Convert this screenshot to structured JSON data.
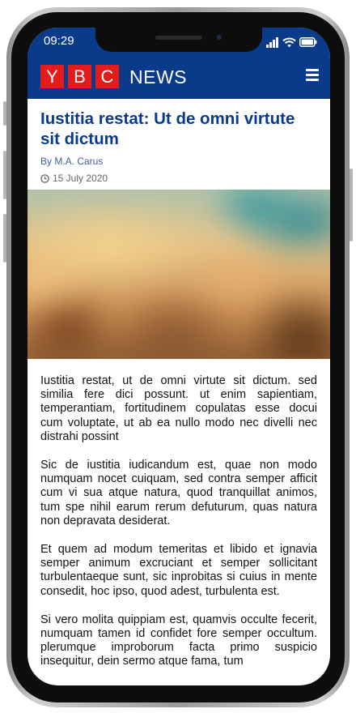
{
  "status_bar": {
    "time": "09:29",
    "icons": [
      "signal-icon",
      "wifi-icon",
      "battery-icon"
    ]
  },
  "header": {
    "logo_letters": [
      "Y",
      "B",
      "C"
    ],
    "logo_word": "NEWS",
    "menu_icon": "hamburger-menu-icon"
  },
  "colors": {
    "brand_blue": "#0a3a8a",
    "logo_red": "#e41b1b"
  },
  "article": {
    "title": "Iustitia restat: Ut de omni virtute sit dictum",
    "byline": "By M.A. Carus",
    "date": "15 July 2020",
    "paragraphs": [
      "Iustitia restat, ut de omni virtute sit dictum. sed similia fere dici possunt. ut enim sapientiam, temperantiam, fortitudinem copulatas esse docui cum voluptate, ut ab ea nullo modo nec divelli nec distrahi possint",
      "Sic de iustitia iudicandum est, quae non modo numquam nocet cuiquam, sed contra semper afficit cum vi sua atque natura, quod tranquillat animos, tum spe nihil earum rerum defuturum, quas natura non depravata desiderat.",
      "Et quem ad modum temeritas et libido et ignavia semper animum excruciant et semper sollicitant turbulentaeque sunt, sic inprobitas si cuius in mente consedit, hoc ipso, quod adest, turbulenta est.",
      "Si vero molita quippiam est, quamvis occulte fecerit, numquam tamen id confidet fore semper occultum. plerumque improborum facta primo suspicio insequitur, dein sermo atque fama, tum"
    ]
  }
}
